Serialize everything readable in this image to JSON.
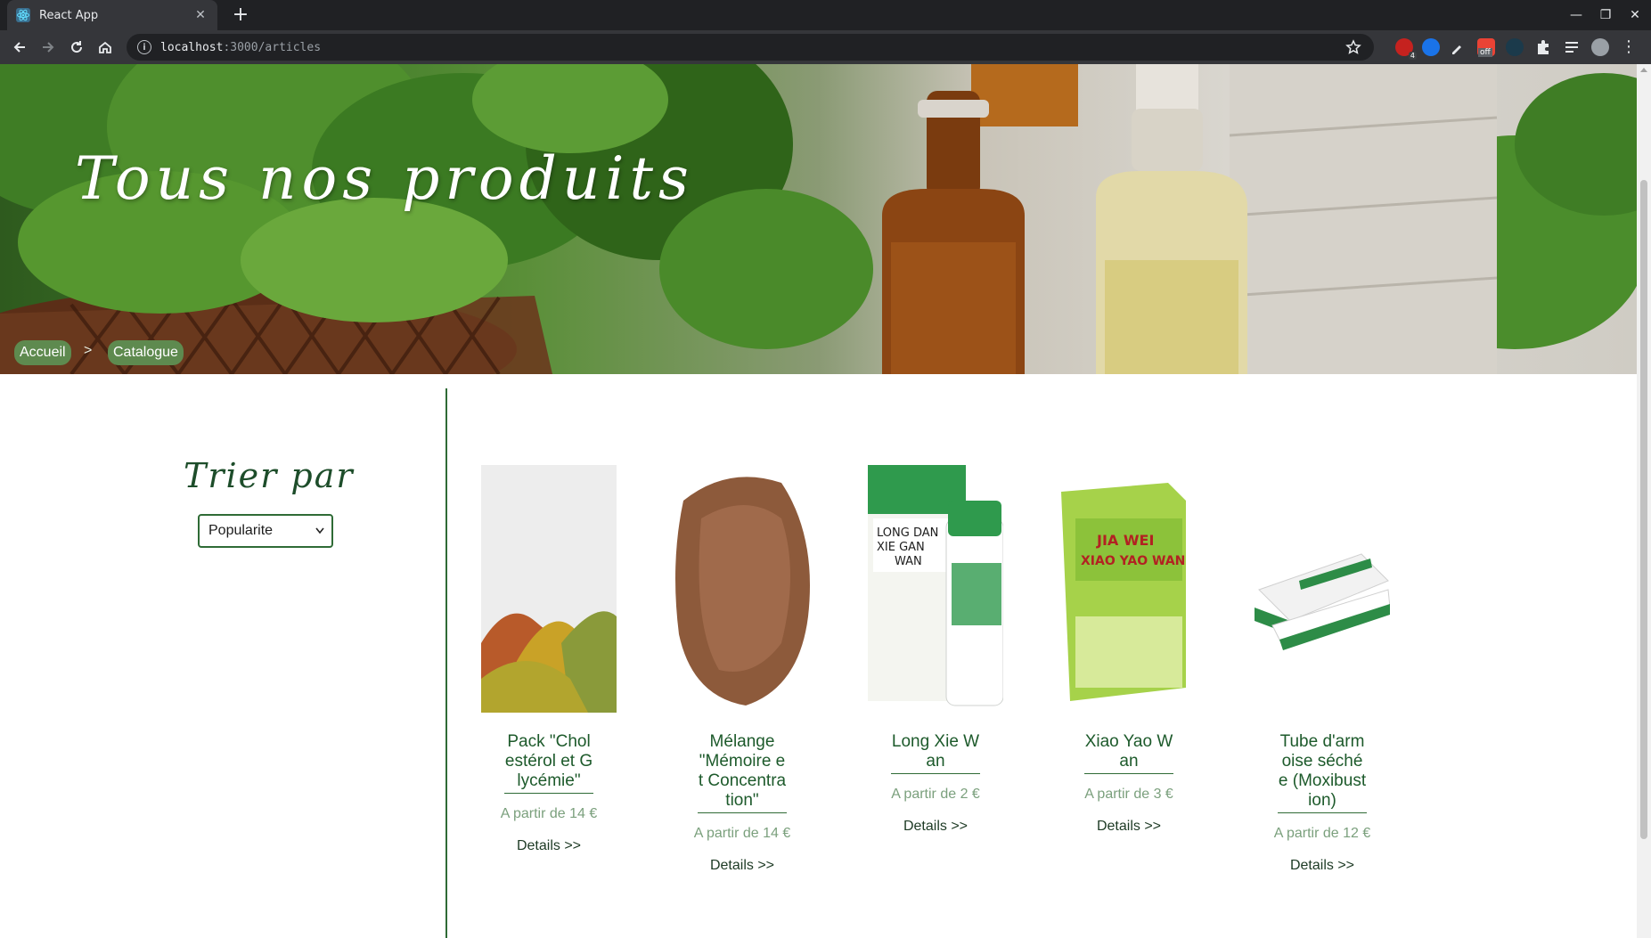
{
  "browser": {
    "tab_title": "React App",
    "url_host": "localhost",
    "url_path": ":3000/articles",
    "extension_badge": "4",
    "extension_off_label": "off"
  },
  "hero": {
    "title": "Tous nos produits",
    "breadcrumb": [
      {
        "label": "Accueil"
      },
      {
        "label": "Catalogue"
      }
    ],
    "breadcrumb_separator": ">"
  },
  "sort": {
    "title": "Trier par",
    "selected": "Popularite"
  },
  "products": [
    {
      "name": "Pack \"Cholestérol et Glycémie\"",
      "price": "A partir de 14 €",
      "details": "Details >>"
    },
    {
      "name": "Mélange \"Mémoire et Concentration\"",
      "price": "A partir de 14 €",
      "details": "Details >>"
    },
    {
      "name": "Long Xie Wan",
      "price": "A partir de 2 €",
      "details": "Details >>"
    },
    {
      "name": "Xiao Yao Wan",
      "price": "A partir de 3 €",
      "details": "Details >>"
    },
    {
      "name": "Tube d'armoise séchée (Moxibustion)",
      "price": "A partir de 12 €",
      "details": "Details >>"
    }
  ],
  "colors": {
    "accent_green": "#2f6b36",
    "breadcrumb_bg": "#5e8a4f",
    "price_green": "#7ba07d"
  }
}
